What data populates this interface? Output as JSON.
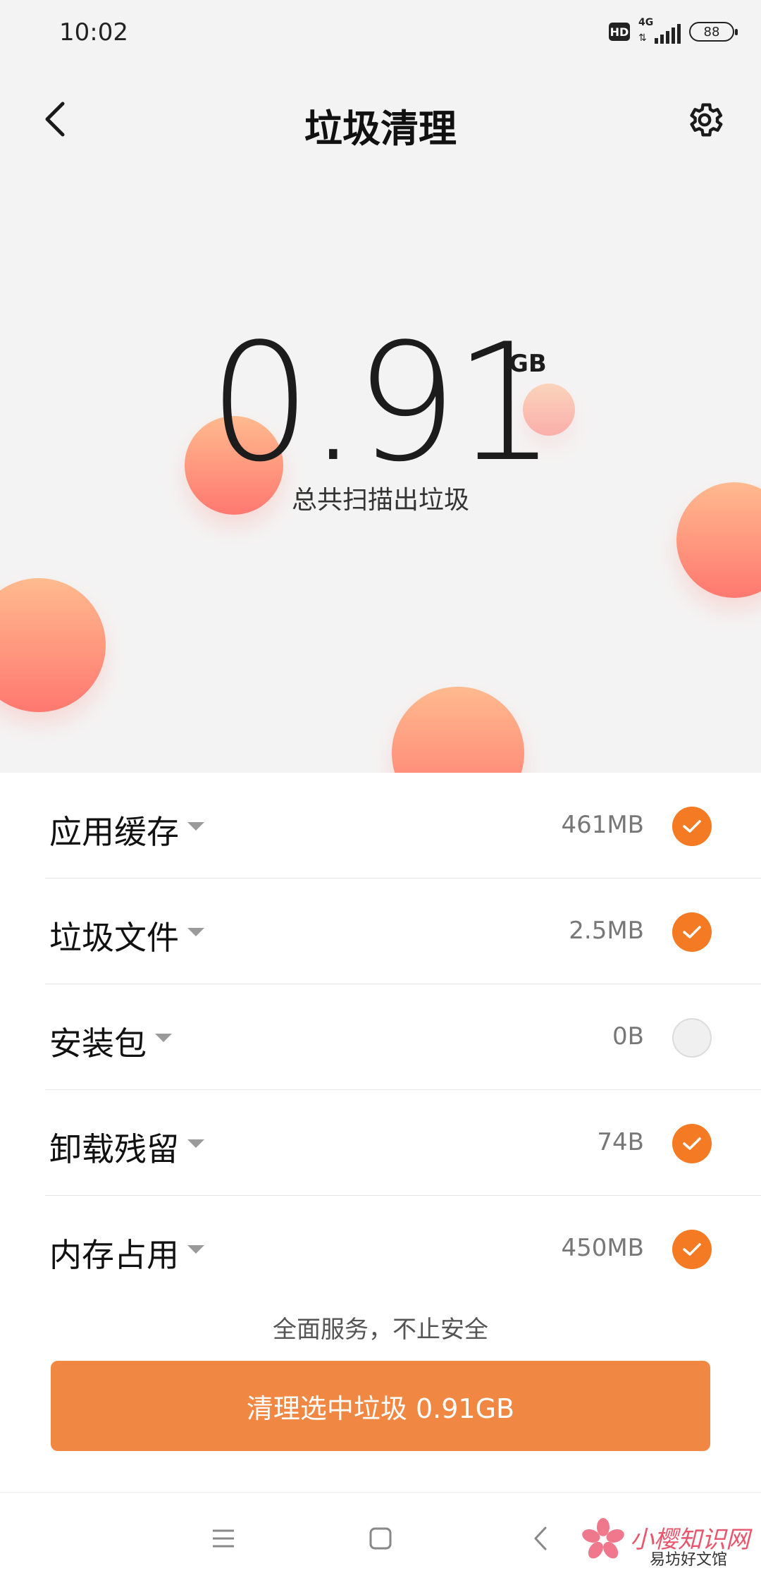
{
  "status_bar": {
    "time": "10:02",
    "hd": "HD",
    "network": "4G",
    "network_arrows": "⇅",
    "battery": "88"
  },
  "header": {
    "title": "垃圾清理",
    "back_icon": "chevron-left-icon",
    "settings_icon": "gear-icon"
  },
  "summary": {
    "total": "0.91",
    "unit": "GB",
    "caption": "总共扫描出垃圾"
  },
  "items": [
    {
      "label": "应用缓存",
      "size": "461MB",
      "checked": true
    },
    {
      "label": "垃圾文件",
      "size": "2.5MB",
      "checked": true
    },
    {
      "label": "安装包",
      "size": "0B",
      "checked": false
    },
    {
      "label": "卸载残留",
      "size": "74B",
      "checked": true
    },
    {
      "label": "内存占用",
      "size": "450MB",
      "checked": true
    }
  ],
  "footer": {
    "slogan": "全面服务，不止安全",
    "clean_button": "清理选中垃圾 0.91GB"
  },
  "nav": {
    "menu_icon": "menu-icon",
    "home_icon": "square-icon",
    "back_icon": "chevron-left-icon"
  },
  "watermark": {
    "brand": "小樱知识网",
    "sub": "易坊好文馆"
  },
  "colors": {
    "accent": "#f47a24",
    "button": "#f08844",
    "bubble_top": "#ffba8e",
    "bubble_bottom": "#ff7870"
  }
}
